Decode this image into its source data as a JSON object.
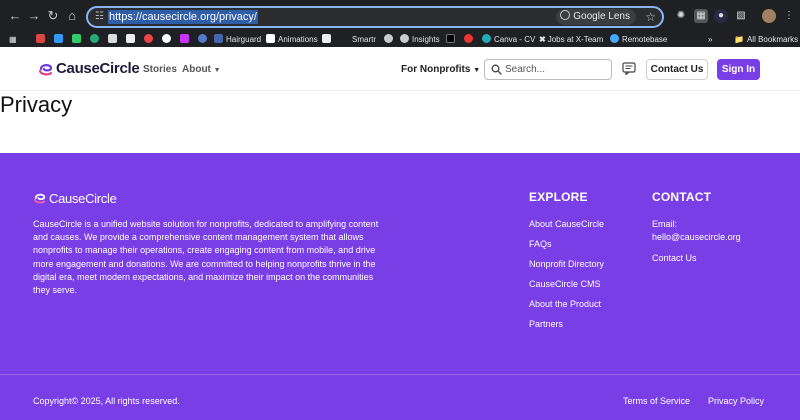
{
  "browser": {
    "url": "https://causecircle.org/privacy/",
    "lens_label": "Google Lens",
    "bookmarks": [
      "Hairguard",
      "Animations",
      "Smartr",
      "Insights",
      "Canva - CV",
      "Jobs at X-Team",
      "Remotebase",
      "All Bookmarks"
    ]
  },
  "header": {
    "logo_text": "CauseCircle",
    "nav": {
      "stories": "Stories",
      "about": "About",
      "nonprofits": "For Nonprofits"
    },
    "search_placeholder": "Search...",
    "contact_label": "Contact Us",
    "signin_label": "Sign In"
  },
  "main": {
    "title": "Privacy"
  },
  "footer": {
    "logo_text": "CauseCircle",
    "description": "CauseCircle is a unified website solution for nonprofits, dedicated to amplifying content and causes. We provide a comprehensive content management system that allows nonprofits to manage their operations, create engaging content from mobile, and drive more engagement and donations. We are committed to helping nonprofits thrive in the digital era, meet modern expectations, and maximize their impact on the communities they serve.",
    "explore": {
      "heading": "EXPLORE",
      "links": [
        "About CauseCircle",
        "FAQs",
        "Nonprofit Directory",
        "CauseCircle CMS",
        "About the Product",
        "Partners"
      ]
    },
    "contact": {
      "heading": "CONTACT",
      "email_label": "Email:",
      "email": "hello@causecircle.org",
      "contact_link": "Contact Us"
    },
    "copyright": "Copyright© 2025, All rights reserved.",
    "legal": {
      "terms": "Terms of Service",
      "privacy": "Privacy Policy"
    }
  },
  "colors": {
    "brand": "#7a3ee6",
    "chrome": "#1f2023",
    "accent_focus": "#8ab4f8"
  }
}
